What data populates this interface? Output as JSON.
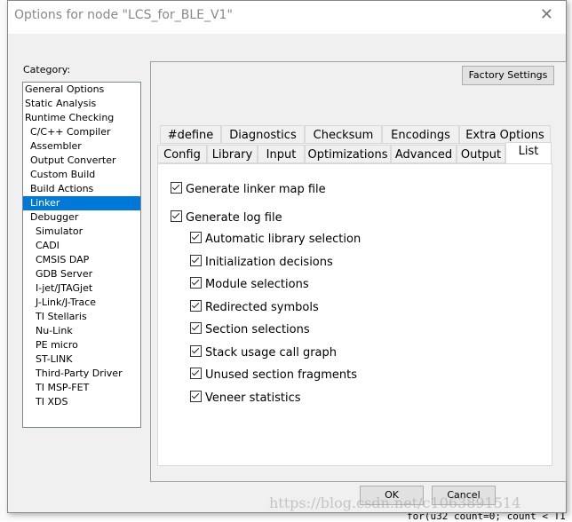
{
  "window": {
    "title": "Options for node \"LCS_for_BLE_V1\"",
    "close_icon": "close-icon"
  },
  "category": {
    "label": "Category:",
    "items": [
      {
        "label": "General Options",
        "level": 0
      },
      {
        "label": "Static Analysis",
        "level": 0
      },
      {
        "label": "Runtime Checking",
        "level": 0
      },
      {
        "label": "C/C++ Compiler",
        "level": 1
      },
      {
        "label": "Assembler",
        "level": 1
      },
      {
        "label": "Output Converter",
        "level": 1
      },
      {
        "label": "Custom Build",
        "level": 1
      },
      {
        "label": "Build Actions",
        "level": 1
      },
      {
        "label": "Linker",
        "level": 1,
        "selected": true
      },
      {
        "label": "Debugger",
        "level": 1
      },
      {
        "label": "Simulator",
        "level": 2
      },
      {
        "label": "CADI",
        "level": 2
      },
      {
        "label": "CMSIS DAP",
        "level": 2
      },
      {
        "label": "GDB Server",
        "level": 2
      },
      {
        "label": "I-jet/JTAGjet",
        "level": 2
      },
      {
        "label": "J-Link/J-Trace",
        "level": 2
      },
      {
        "label": "TI Stellaris",
        "level": 2
      },
      {
        "label": "Nu-Link",
        "level": 2
      },
      {
        "label": "PE micro",
        "level": 2
      },
      {
        "label": "ST-LINK",
        "level": 2
      },
      {
        "label": "Third-Party Driver",
        "level": 2
      },
      {
        "label": "TI MSP-FET",
        "level": 2
      },
      {
        "label": "TI XDS",
        "level": 2
      }
    ]
  },
  "factory_settings": "Factory Settings",
  "tabs_row1": [
    "#define",
    "Diagnostics",
    "Checksum",
    "Encodings",
    "Extra Options"
  ],
  "tabs_row2": [
    "Config",
    "Library",
    "Input",
    "Optimizations",
    "Advanced",
    "Output",
    "List"
  ],
  "selected_tab": "List",
  "options": {
    "map_file": {
      "label": "Generate linker map file",
      "checked": true
    },
    "log_file": {
      "label": "Generate log file",
      "checked": true
    },
    "log_items": [
      {
        "label": "Automatic library selection",
        "checked": true
      },
      {
        "label": "Initialization decisions",
        "checked": true
      },
      {
        "label": "Module selections",
        "checked": true
      },
      {
        "label": "Redirected symbols",
        "checked": true
      },
      {
        "label": "Section selections",
        "checked": true
      },
      {
        "label": "Stack usage call graph",
        "checked": true
      },
      {
        "label": "Unused section fragments",
        "checked": true
      },
      {
        "label": "Veneer statistics",
        "checked": true
      }
    ]
  },
  "ok": "OK",
  "cancel": "Cancel",
  "watermark": "https://blog.csdn.net/c1063891514",
  "background_code": "for(u32 count=0; count < T1"
}
